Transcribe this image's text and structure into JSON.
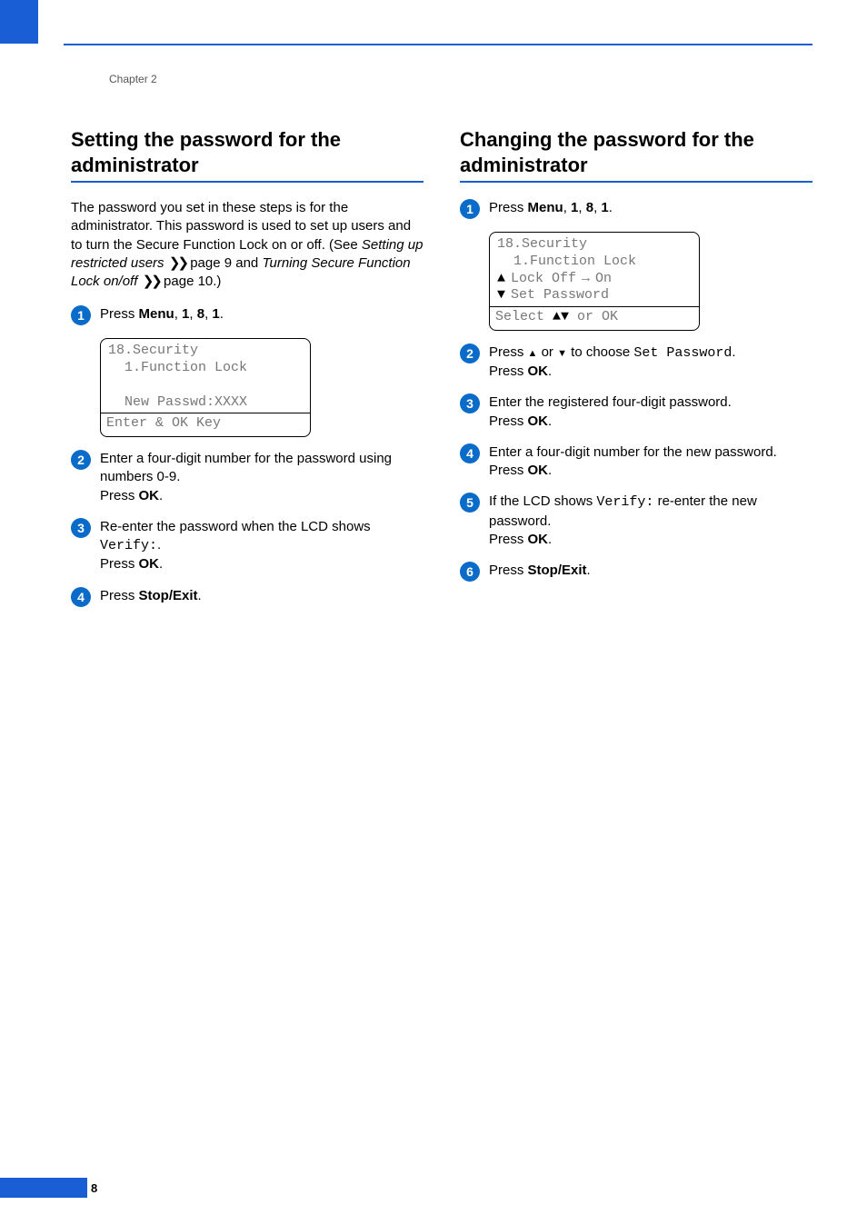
{
  "chapter_label": "Chapter 2",
  "page_number": "8",
  "left": {
    "title": "Setting the password for the administrator",
    "intro_1": "The password you set in these steps is for the administrator. This password is used to set up users and to turn the Secure Function Lock on or off. (See ",
    "link1": "Setting up restricted users",
    "intro_2": " page 9 and ",
    "link2": "Turning Secure Function Lock on/off",
    "intro_3": " page 10.)",
    "step1_prefix": "Press ",
    "menu_seq": [
      "Menu",
      "1",
      "8",
      "1"
    ],
    "lcd_lines": "18.Security\n  1.Function Lock\n\n  New Passwd:XXXX",
    "lcd_footer": "Enter & OK Key",
    "step2_a": "Enter a four-digit number for the password using numbers 0-9.",
    "step2_b": "Press ",
    "ok": "OK",
    "step3_a": "Re-enter the password when the LCD shows ",
    "verify": "Verify:",
    "step3_b": ".",
    "step3_c": "Press ",
    "step4_a": "Press ",
    "stopexit": "Stop/Exit",
    "step4_b": "."
  },
  "right": {
    "title": "Changing the password for the administrator",
    "step1_prefix": "Press ",
    "menu_seq": [
      "Menu",
      "1",
      "8",
      "1"
    ],
    "lcd_lines_a": "18.Security\n  1.Function Lock",
    "lcd_line_up": "Lock Off",
    "lcd_line_up_arrow": "→",
    "lcd_line_up_after": "On",
    "lcd_line_dn": "Set Password",
    "lcd_footer": "Select ab or OK",
    "step2_a": "Press ",
    "step2_b": " or ",
    "step2_c": " to choose ",
    "setpwd": "Set Password",
    "step2_d": ".",
    "step2_e": "Press ",
    "ok": "OK",
    "step3_a": "Enter the registered four-digit password.",
    "step3_b": "Press ",
    "step4_a": "Enter a four-digit number for the new password.",
    "step4_b": "Press ",
    "step5_a": "If the LCD shows ",
    "verify": "Verify:",
    "step5_b": " re-enter the new password.",
    "step5_c": "Press ",
    "step6_a": "Press ",
    "stopexit": "Stop/Exit",
    "step6_b": "."
  }
}
